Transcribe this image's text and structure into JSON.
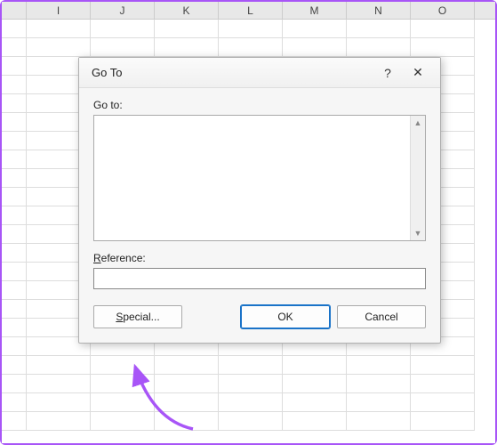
{
  "columns": [
    "I",
    "J",
    "K",
    "L",
    "M",
    "N",
    "O"
  ],
  "dialog": {
    "title": "Go To",
    "help_symbol": "?",
    "close_symbol": "✕",
    "goto_label": "Go to:",
    "reference_label": "Reference:",
    "reference_value": "",
    "buttons": {
      "special": "Special...",
      "ok": "OK",
      "cancel": "Cancel"
    },
    "scroll_up": "▲",
    "scroll_down": "▼"
  }
}
